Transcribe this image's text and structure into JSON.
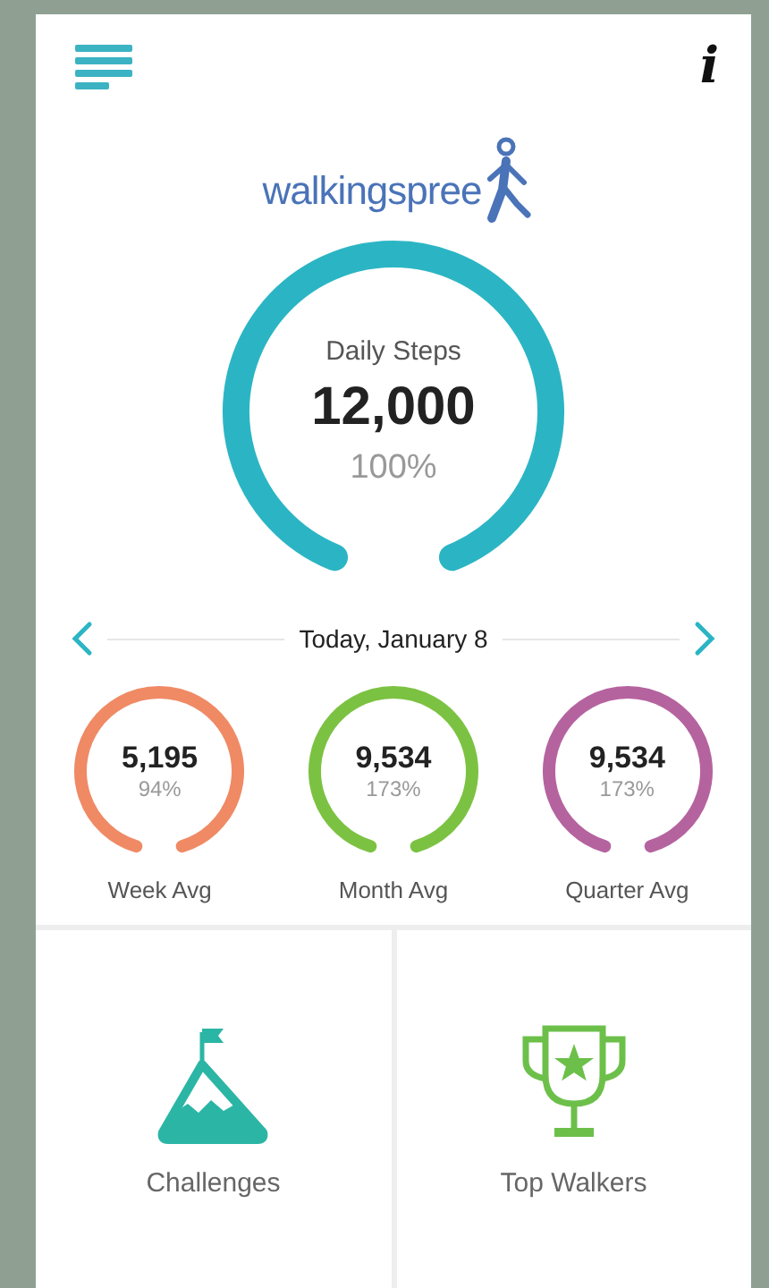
{
  "header": {
    "info": "i"
  },
  "logo": {
    "text": "walkingspree"
  },
  "daily": {
    "label": "Daily Steps",
    "value": "12,000",
    "percent": "100%",
    "color": "#2bb5c4"
  },
  "date": {
    "text": "Today, January 8"
  },
  "averages": [
    {
      "value": "5,195",
      "percent": "94%",
      "label": "Week Avg",
      "color": "#ef8a65"
    },
    {
      "value": "9,534",
      "percent": "173%",
      "label": "Month Avg",
      "color": "#7cc242"
    },
    {
      "value": "9,534",
      "percent": "173%",
      "label": "Quarter Avg",
      "color": "#b5639f"
    }
  ],
  "tiles": [
    {
      "kind": "challenges",
      "label": "Challenges"
    },
    {
      "kind": "trophy",
      "label": "Top Walkers"
    }
  ]
}
